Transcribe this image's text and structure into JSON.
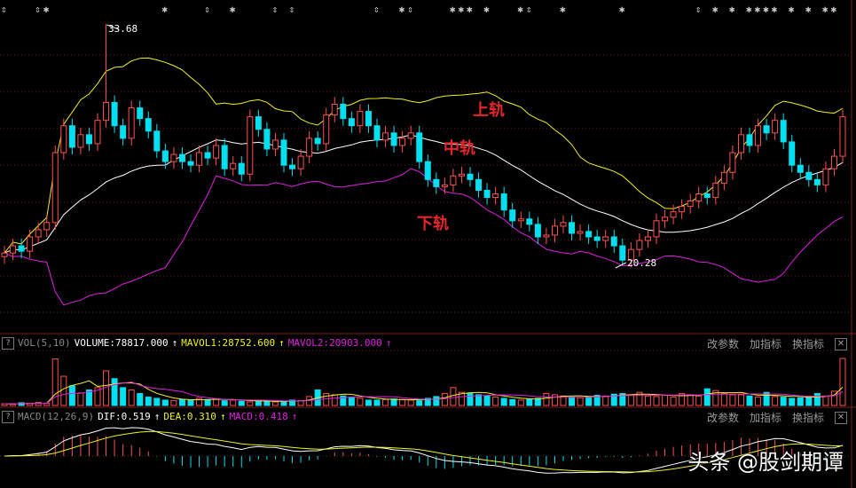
{
  "chart_data": {
    "type": "candlestick",
    "indicator_labels": {
      "upper": "上轨",
      "middle": "中轨",
      "lower": "下轨"
    },
    "close": [
      20.9,
      21.3,
      21.0,
      21.8,
      22.2,
      22.6,
      26.5,
      28.0,
      26.8,
      27.5,
      27.0,
      28.3,
      29.3,
      28.0,
      27.3,
      29.0,
      28.4,
      27.7,
      26.6,
      26.0,
      26.4,
      26.0,
      25.8,
      26.5,
      26.2,
      26.9,
      25.6,
      25.9,
      25.3,
      28.5,
      27.8,
      26.7,
      27.2,
      25.8,
      25.6,
      26.3,
      27.3,
      27.0,
      28.6,
      29.2,
      28.4,
      28.0,
      28.8,
      28.0,
      27.2,
      27.6,
      26.9,
      27.3,
      27.6,
      26.0,
      25.0,
      24.6,
      24.7,
      25.2,
      25.3,
      25.0,
      24.4,
      24.0,
      24.2,
      23.3,
      22.7,
      22.8,
      22.5,
      21.8,
      21.9,
      22.4,
      22.6,
      22.0,
      22.1,
      21.8,
      21.6,
      21.8,
      21.3,
      20.5,
      21.1,
      21.6,
      21.8,
      22.7,
      22.9,
      23.2,
      23.5,
      23.8,
      24.2,
      24.0,
      24.8,
      25.4,
      26.5,
      27.5,
      26.9,
      28.0,
      27.6,
      28.3,
      27.1,
      25.8,
      25.4,
      25.0,
      24.7,
      25.6,
      26.3,
      28.5
    ],
    "volume": [
      3000,
      2500,
      4500,
      3500,
      5000,
      4000,
      78000,
      49000,
      33000,
      21000,
      26000,
      30000,
      58000,
      45000,
      30000,
      26000,
      20000,
      14000,
      12000,
      9000,
      8000,
      10000,
      9000,
      12000,
      10000,
      11000,
      8000,
      9000,
      7000,
      6000,
      8000,
      7000,
      6000,
      7000,
      9000,
      8000,
      15000,
      26000,
      20000,
      18000,
      16000,
      14000,
      12000,
      9000,
      9000,
      10000,
      11000,
      10000,
      9000,
      8000,
      12000,
      15000,
      20000,
      30000,
      22000,
      20000,
      18000,
      16000,
      14000,
      12000,
      10000,
      9000,
      11000,
      12000,
      20000,
      18000,
      16000,
      14000,
      13000,
      15000,
      17000,
      16000,
      19000,
      20000,
      18000,
      22000,
      16000,
      15000,
      17000,
      14000,
      20000,
      18000,
      16000,
      28000,
      25000,
      20000,
      18000,
      18000,
      16000,
      14000,
      22000,
      15000,
      14000,
      12000,
      13000,
      14000,
      20000,
      16000,
      24000,
      78817
    ],
    "extremes": {
      "high": {
        "index": 12,
        "value": 33.68,
        "label": "33.68"
      },
      "low": {
        "index": 73,
        "value": 20.28,
        "label": "20.28"
      }
    },
    "price_range": [
      16.5,
      35
    ],
    "info_markers": [
      [
        0,
        "⇕"
      ],
      [
        4,
        "⇕"
      ],
      [
        5,
        "✱"
      ],
      [
        19,
        "✱"
      ],
      [
        24,
        "⇕"
      ],
      [
        27,
        "✱"
      ],
      [
        32,
        "⇕"
      ],
      [
        34,
        "⇕"
      ],
      [
        44,
        "⇕"
      ],
      [
        47,
        "✱"
      ],
      [
        48,
        "⇕"
      ],
      [
        53,
        "✱"
      ],
      [
        54,
        "✱"
      ],
      [
        55,
        "✱"
      ],
      [
        57,
        "✱"
      ],
      [
        61,
        "✱"
      ],
      [
        62,
        "⇕"
      ],
      [
        66,
        "✱"
      ],
      [
        73,
        "✱"
      ],
      [
        82,
        "⇕"
      ],
      [
        84,
        "✱"
      ],
      [
        86,
        "✱"
      ],
      [
        88,
        "✱"
      ],
      [
        89,
        "✱"
      ],
      [
        90,
        "✱"
      ],
      [
        91,
        "✱"
      ],
      [
        93,
        "✱"
      ],
      [
        95,
        "✱"
      ],
      [
        97,
        "✱"
      ],
      [
        98,
        "✱"
      ]
    ]
  },
  "vol_header": {
    "name": "VOL(5,10)",
    "volume": "VOLUME:78817.000",
    "mavol1": "MAVOL1:28752.600",
    "mavol2": "MAVOL2:20903.000",
    "arrow": "↑"
  },
  "macd_header": {
    "name": "MACD(12,26,9)",
    "dif": "DIF:0.519",
    "dea": "DEA:0.310",
    "macd": "MACD:0.418",
    "arrow": "↑"
  },
  "tools": {
    "modify": "改参数",
    "add": "加指标",
    "switch": "换指标",
    "close": "✕",
    "help": "?"
  },
  "watermark": "头条 @股剑期谭",
  "colors": {
    "up": "#ff5050",
    "down": "#00e0f0",
    "upper": "#f0f020",
    "middle": "#ffffff",
    "lower": "#e020e0",
    "grid": "#7a2020"
  }
}
